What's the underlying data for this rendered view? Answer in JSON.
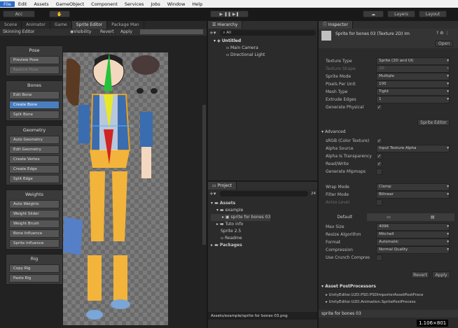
{
  "menu": [
    "File",
    "Edit",
    "Assets",
    "GameObject",
    "Component",
    "Services",
    "Jobs",
    "Window",
    "Help"
  ],
  "toolbar": {
    "account": "Acc",
    "layers": "Layers",
    "layout": "Layout"
  },
  "scene_tabs": [
    "Scene",
    "Animator",
    "Game",
    "Sprite Editor",
    "Package Man"
  ],
  "sprite_editor": {
    "mode": "Skinning Editor",
    "visibility": "Visibility",
    "revert": "Revert",
    "apply": "Apply",
    "groups": [
      {
        "title": "Pose",
        "buttons": [
          "Preview Pose",
          "Restore Pose"
        ]
      },
      {
        "title": "Bones",
        "buttons": [
          "Edit Bone",
          "Create Bone",
          "Split Bone"
        ]
      },
      {
        "title": "Geometry",
        "buttons": [
          "Auto Geometry",
          "Edit Geometry",
          "Create Vertex",
          "Create Edge",
          "Split Edge"
        ]
      },
      {
        "title": "Weights",
        "buttons": [
          "Auto Weights",
          "Weight Slider",
          "Weight Brush",
          "Bone Influence",
          "Sprite Influence"
        ]
      },
      {
        "title": "Rig",
        "buttons": [
          "Copy Rig",
          "Paste Rig"
        ]
      }
    ]
  },
  "hierarchy": {
    "tab": "Hierarchy",
    "search": "All",
    "scene": "Untitled",
    "items": [
      "Main Camera",
      "Directional Light"
    ]
  },
  "project": {
    "tab": "Project",
    "count": "24",
    "tree": [
      "Assets",
      "example",
      "sprite for bones 03",
      "Tuto info",
      "Sprite 2.5",
      "Readme",
      "Packages"
    ],
    "footer": "Assets/example/sprite for bones 03.png"
  },
  "inspector": {
    "tab": "Inspector",
    "title": "Sprite for bones 03 (Texture 2D) Im",
    "open": "Open",
    "rows": [
      {
        "label": "Texture Type",
        "value": "Sprite (2D and UI)",
        "dim": false
      },
      {
        "label": "Texture Shape",
        "value": "2D",
        "dim": true
      },
      {
        "label": "Sprite Mode",
        "value": "Multiple",
        "dim": false
      },
      {
        "label": "Pixels Per Unit",
        "value": "100",
        "dim": false
      },
      {
        "label": "Mesh Type",
        "value": "Tight",
        "dim": false
      },
      {
        "label": "Extrude Edges",
        "value": "1",
        "dim": false
      },
      {
        "label": "Generate Physical",
        "value": "✓",
        "dim": false
      }
    ],
    "sprite_editor_btn": "Sprite Editor",
    "advanced": "Advanced",
    "adv_rows": [
      {
        "label": "sRGB (Color Texture)",
        "value": "✓"
      },
      {
        "label": "Alpha Source",
        "value": "Input Texture Alpha"
      },
      {
        "label": "Alpha Is Transparency",
        "value": "✓"
      },
      {
        "label": "Read/Write",
        "value": "✓"
      },
      {
        "label": "Generate Mipmaps",
        "value": ""
      }
    ],
    "wrap_rows": [
      {
        "label": "Wrap Mode",
        "value": "Clamp",
        "dim": false
      },
      {
        "label": "Filter Mode",
        "value": "Bilinear",
        "dim": false
      },
      {
        "label": "Aniso Level",
        "value": "",
        "dim": true
      }
    ],
    "platform_tab": "Default",
    "platform_rows": [
      {
        "label": "Max Size",
        "value": "4096"
      },
      {
        "label": "Resize Algorithm",
        "value": "Mitchell"
      },
      {
        "label": "Format",
        "value": "Automatic"
      },
      {
        "label": "Compression",
        "value": "Normal Quality"
      },
      {
        "label": "Use Crunch Compres",
        "value": ""
      }
    ],
    "revert": "Revert",
    "apply": "Apply",
    "postproc": "Asset PostProcessors",
    "postproc_items": [
      "UnityEditor.U2D.PSD.PSDImporterAssetPostProce",
      "UnityEditor.U2D.Animation.SpritePostProcess"
    ],
    "footer": "sprite for bones 03",
    "resolution": "1.106×801"
  }
}
